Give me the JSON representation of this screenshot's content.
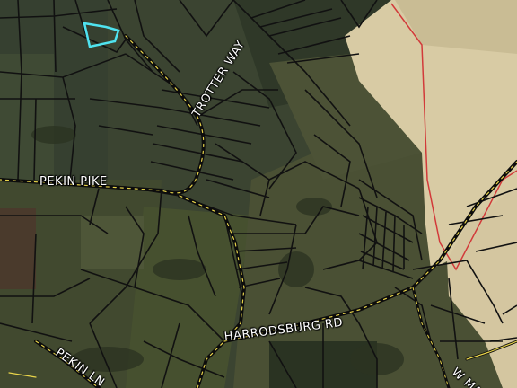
{
  "map": {
    "type": "aerial-parcel-map",
    "colors": {
      "parcel_lines": "#111111",
      "road_centerline": "#e8d44a",
      "selected_parcel": "#4fe3f0",
      "county_boundary": "#d23a3a",
      "pale_area": "#d8cba4"
    }
  },
  "road_labels": {
    "trotter_way": "TROTTER WAY",
    "pekin_pike": "PEKIN PIKE",
    "harrodsburg_rd": "HARRODSBURG RD",
    "pekin_ln": "PEKIN LN",
    "w_ma": "W MA"
  },
  "selected_parcel": {
    "icon": "highlighted-parcel-outline"
  }
}
